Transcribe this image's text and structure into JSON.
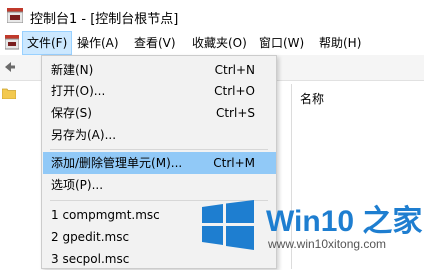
{
  "window": {
    "title": "控制台1 - [控制台根节点]"
  },
  "menubar": {
    "items": [
      {
        "label": "文件(F)"
      },
      {
        "label": "操作(A)"
      },
      {
        "label": "查看(V)"
      },
      {
        "label": "收藏夹(O)"
      },
      {
        "label": "窗口(W)"
      },
      {
        "label": "帮助(H)"
      }
    ]
  },
  "list_pane": {
    "column_header": "名称"
  },
  "file_menu": {
    "items": [
      {
        "label": "新建(N)",
        "shortcut": "Ctrl+N"
      },
      {
        "label": "打开(O)...",
        "shortcut": "Ctrl+O"
      },
      {
        "label": "保存(S)",
        "shortcut": "Ctrl+S"
      },
      {
        "label": "另存为(A)...",
        "shortcut": ""
      },
      {
        "label": "添加/删除管理单元(M)...",
        "shortcut": "Ctrl+M"
      },
      {
        "label": "选项(P)...",
        "shortcut": ""
      },
      {
        "label": "1 compmgmt.msc",
        "shortcut": ""
      },
      {
        "label": "2 gpedit.msc",
        "shortcut": ""
      },
      {
        "label": "3 secpol.msc",
        "shortcut": ""
      }
    ],
    "highlighted_index": 4
  },
  "watermark": {
    "brand": "Win10 之家",
    "url": "www.win10xitong.com"
  },
  "colors": {
    "menu_highlight": "#91c9f7",
    "menubar_active": "#cce8ff",
    "brand_blue": "#1e7ed0"
  }
}
